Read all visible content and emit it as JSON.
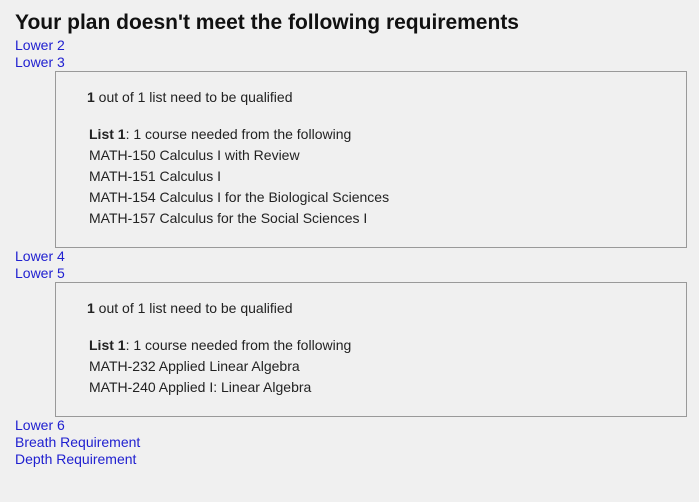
{
  "title": "Your plan doesn't meet the following requirements",
  "requirements": {
    "lower2": "Lower 2",
    "lower3": "Lower 3",
    "lower4": "Lower 4",
    "lower5": "Lower 5",
    "lower6": "Lower 6",
    "breadth": "Breath Requirement",
    "depth": "Depth Requirement"
  },
  "lower3_box": {
    "qualified_count": "1",
    "qualified_text": " out of 1 list need to be qualified",
    "list_label": "List 1",
    "list_text": ": 1 course needed from the following",
    "courses": [
      "MATH-150 Calculus I with Review",
      "MATH-151 Calculus I",
      "MATH-154 Calculus I for the Biological Sciences",
      "MATH-157 Calculus for the Social Sciences I"
    ]
  },
  "lower5_box": {
    "qualified_count": "1",
    "qualified_text": " out of 1 list need to be qualified",
    "list_label": "List 1",
    "list_text": ": 1 course needed from the following",
    "courses": [
      "MATH-232 Applied Linear Algebra",
      "MATH-240 Applied I: Linear Algebra"
    ]
  }
}
